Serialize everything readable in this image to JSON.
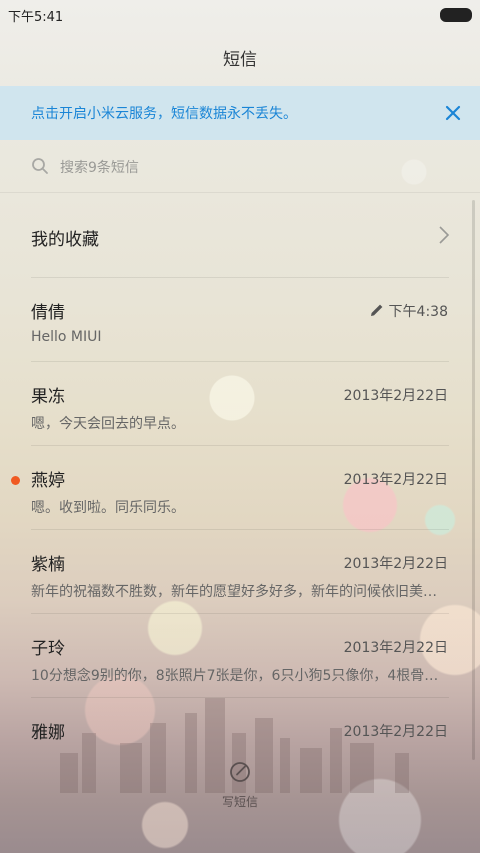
{
  "status_bar": {
    "time": "下午5:41"
  },
  "header": {
    "title": "短信"
  },
  "cloud_banner": {
    "text": "点击开启小米云服务，短信数据永不丢失。",
    "close_icon": "close-icon",
    "accent_color": "#1a85d6"
  },
  "search": {
    "placeholder": "搜索9条短信",
    "value": ""
  },
  "favorites": {
    "label": "我的收藏"
  },
  "conversations": [
    {
      "name": "倩倩",
      "preview": "Hello MIUI",
      "time": "下午4:38",
      "draft": true,
      "unread": false
    },
    {
      "name": "果冻",
      "preview": "嗯，今天会回去的早点。",
      "time": "2013年2月22日",
      "draft": false,
      "unread": false
    },
    {
      "name": "燕婷",
      "preview": "嗯。收到啦。同乐同乐。",
      "time": "2013年2月22日",
      "draft": false,
      "unread": true
    },
    {
      "name": "紫楠",
      "preview": "新年的祝福数不胜数，新年的愿望好多好多，新年的问候依旧美…",
      "time": "2013年2月22日",
      "draft": false,
      "unread": false
    },
    {
      "name": "子玲",
      "preview": "10分想念9别的你，8张照片7张是你，6只小狗5只像你，4根骨…",
      "time": "2013年2月22日",
      "draft": false,
      "unread": false
    },
    {
      "name": "雅娜",
      "preview": "",
      "time": "2013年2月22日",
      "draft": false,
      "unread": false
    }
  ],
  "compose": {
    "label": "写短信"
  },
  "colors": {
    "unread_dot": "#f05a22"
  }
}
